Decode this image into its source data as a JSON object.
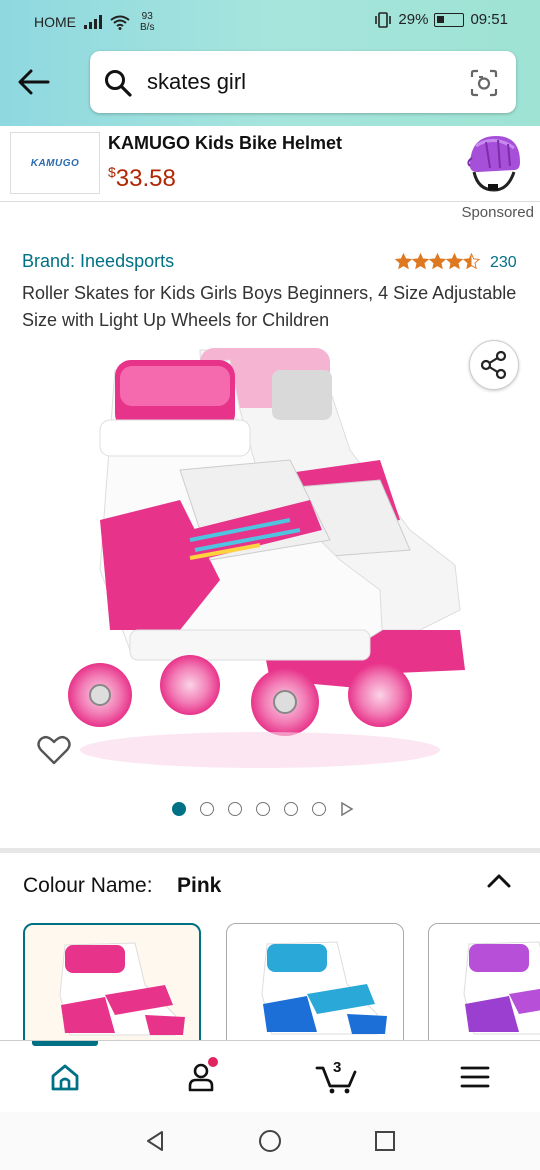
{
  "status_bar": {
    "carrier": "HOME",
    "speed_value": "93",
    "speed_unit": "B/s",
    "battery": "29%",
    "time": "09:51"
  },
  "search": {
    "query": "skates girl"
  },
  "ad": {
    "logo_text": "KAMUGO",
    "title": "KAMUGO Kids Bike Helmet",
    "price_symbol": "$",
    "price": "33.58",
    "sponsored_label": "Sponsored"
  },
  "product": {
    "brand": "Brand: Ineedsports",
    "rating": 4.5,
    "rating_count": "230",
    "title": "Roller Skates for Kids Girls Boys Beginners, 4 Size Adjustable Size with Light Up Wheels for Children",
    "image_count": 6,
    "active_image": 1
  },
  "colour": {
    "label": "Colour Name:",
    "value": "Pink",
    "options": [
      "Pink",
      "Blue",
      "Purple"
    ]
  },
  "bottom_nav": {
    "items": [
      "home-icon",
      "account-icon",
      "cart-icon",
      "menu-icon"
    ],
    "cart_count": "3"
  },
  "colors": {
    "accent": "#007185",
    "price": "#b12704",
    "skate_pink": "#e8338a"
  }
}
